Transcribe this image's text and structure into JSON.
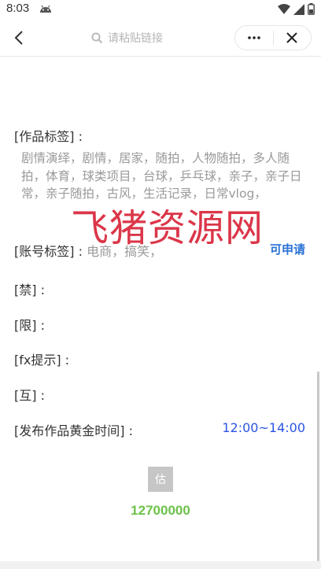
{
  "status_bar": {
    "time": "8:03"
  },
  "nav": {
    "search_placeholder": "请粘贴链接"
  },
  "fields": {
    "works_tags_label": "[作品标签] :",
    "works_tags_value": "剧情演绎，剧情，居家，随拍，人物随拍，多人随拍，体育，球类项目，台球，乒乓球，亲子，亲子日常，亲子随拍，古风，生活记录，日常vlog，",
    "account_tags_label": "[账号标签] :",
    "account_tags_value": "电商，搞笑，",
    "apply_link": "可申请",
    "ban_label": "[禁] :",
    "limit_label": "[限] :",
    "fx_label": "[fx提示] :",
    "mutual_label": "[互] :",
    "golden_time_label": "[发布作品黄金时间] :",
    "golden_time_value": "12:00~14:00"
  },
  "estimate": {
    "button_label": "估",
    "value": "12700000"
  },
  "watermark": "飞猪资源网",
  "colors": {
    "accent_blue": "#2b72d6",
    "time_blue": "#2b54e3",
    "value_green": "#6cc24a",
    "watermark_red": "#d9253a"
  },
  "icons": [
    "android-icon",
    "wifi-icon",
    "signal-icon",
    "battery-icon",
    "back-arrow-icon",
    "search-icon",
    "more-icon",
    "close-icon"
  ]
}
